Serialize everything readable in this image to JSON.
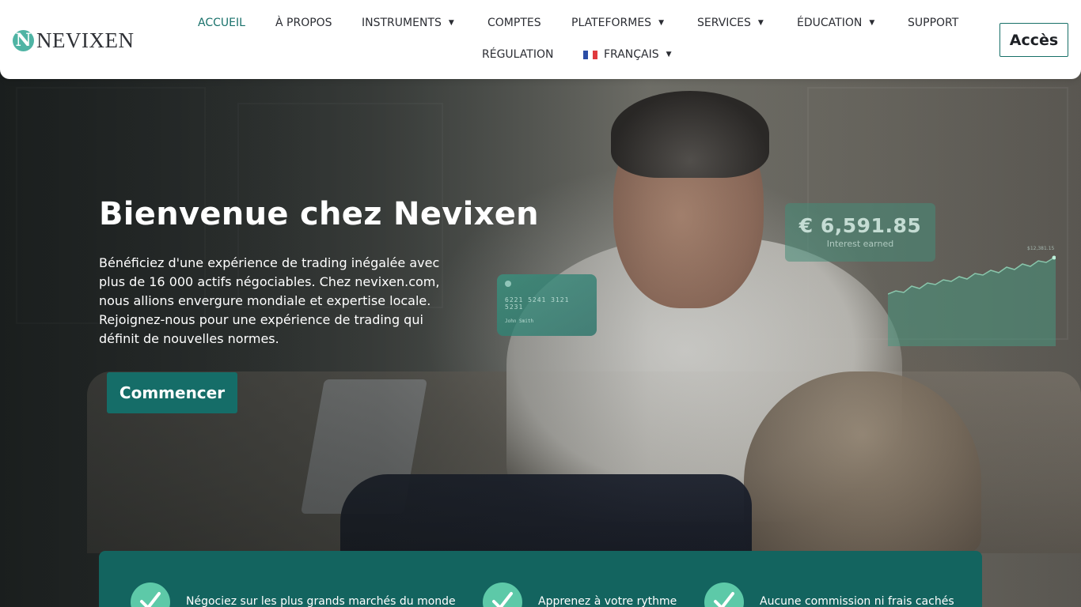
{
  "brand": {
    "name": "NEVIXEN",
    "mark_letter": "N",
    "colors": {
      "primary": "#156d68",
      "accent": "#5dc9a8",
      "nav_active": "#19716b"
    }
  },
  "nav": {
    "items": [
      {
        "label": "ACCUEIL",
        "active": true,
        "has_dropdown": false
      },
      {
        "label": "À PROPOS",
        "active": false,
        "has_dropdown": false
      },
      {
        "label": "INSTRUMENTS",
        "active": false,
        "has_dropdown": true
      },
      {
        "label": "COMPTES",
        "active": false,
        "has_dropdown": false
      },
      {
        "label": "PLATEFORMES",
        "active": false,
        "has_dropdown": true
      },
      {
        "label": "SERVICES",
        "active": false,
        "has_dropdown": true
      },
      {
        "label": "ÉDUCATION",
        "active": false,
        "has_dropdown": true
      },
      {
        "label": "SUPPORT",
        "active": false,
        "has_dropdown": false
      },
      {
        "label": "RÉGULATION",
        "active": false,
        "has_dropdown": false
      }
    ],
    "language": {
      "label": "FRANÇAIS",
      "flag_icon": "france-flag-icon"
    },
    "dropdown_icon": "caret-down-icon",
    "access_label": "Accès"
  },
  "hero": {
    "title": "Bienvenue chez Nevixen",
    "text": "Bénéficiez d'une expérience de trading inégalée avec plus de 16 000 actifs négociables. Chez nevixen.com, nous allions envergure mondiale et expertise locale. Rejoignez-nous pour une expérience de trading qui définit de nouvelles normes.",
    "cta_label": "Commencer",
    "card": {
      "number": "6221 5241 3121 5231",
      "holder": "John Smith"
    },
    "interest": {
      "amount": "€ 6,591.85",
      "caption": "Interest earned"
    },
    "mini_chart_label": "$12,381.15"
  },
  "features": [
    {
      "icon": "checkmark-icon",
      "label": "Négociez sur les plus grands marchés du monde"
    },
    {
      "icon": "checkmark-icon",
      "label": "Apprenez à votre rythme"
    },
    {
      "icon": "checkmark-icon",
      "label": "Aucune commission ni frais cachés"
    }
  ]
}
